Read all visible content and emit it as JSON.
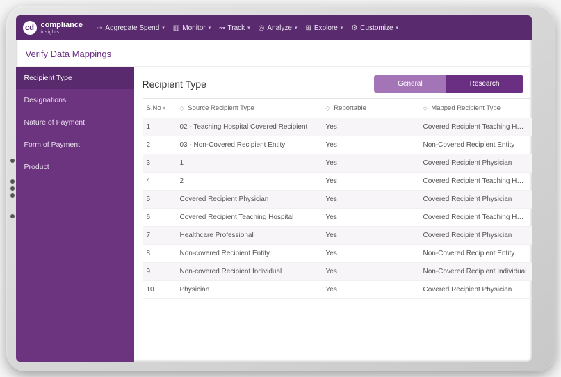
{
  "brand": {
    "name": "compliance",
    "sub": "insights",
    "logo_text": "cd"
  },
  "topnav": [
    {
      "label": "Aggregate Spend"
    },
    {
      "label": "Monitor"
    },
    {
      "label": "Track"
    },
    {
      "label": "Analyze"
    },
    {
      "label": "Explore"
    },
    {
      "label": "Customize"
    }
  ],
  "page_title": "Verify Data Mappings",
  "sidebar": {
    "items": [
      {
        "label": "Recipient Type",
        "active": true
      },
      {
        "label": "Designations"
      },
      {
        "label": "Nature of Payment"
      },
      {
        "label": "Form of Payment"
      },
      {
        "label": "Product"
      }
    ]
  },
  "main": {
    "title": "Recipient Type",
    "tabs": {
      "general": "General",
      "research": "Research"
    },
    "columns": {
      "sno": "S.No",
      "source": "Source Recipient Type",
      "reportable": "Reportable",
      "mapped": "Mapped Recipient Type"
    },
    "rows": [
      {
        "sno": "1",
        "source": "02 - Teaching Hospital Covered Recipient",
        "reportable": "Yes",
        "mapped": "Covered Recipient Teaching Hospital"
      },
      {
        "sno": "2",
        "source": "03 - Non-Covered Recipient Entity",
        "reportable": "Yes",
        "mapped": "Non-Covered Recipient Entity"
      },
      {
        "sno": "3",
        "source": "1",
        "reportable": "Yes",
        "mapped": "Covered Recipient Physician"
      },
      {
        "sno": "4",
        "source": "2",
        "reportable": "Yes",
        "mapped": "Covered Recipient Teaching Hospital"
      },
      {
        "sno": "5",
        "source": "Covered Recipient Physician",
        "reportable": "Yes",
        "mapped": "Covered Recipient Physician"
      },
      {
        "sno": "6",
        "source": "Covered Recipient Teaching Hospital",
        "reportable": "Yes",
        "mapped": "Covered Recipient Teaching Hospital"
      },
      {
        "sno": "7",
        "source": "Healthcare Professional",
        "reportable": "Yes",
        "mapped": "Covered Recipient Physician"
      },
      {
        "sno": "8",
        "source": "Non-covered Recipient Entity",
        "reportable": "Yes",
        "mapped": "Non-Covered Recipient Entity"
      },
      {
        "sno": "9",
        "source": "Non-covered Recipient Individual",
        "reportable": "Yes",
        "mapped": "Non-Covered Recipient Individual"
      },
      {
        "sno": "10",
        "source": "Physician",
        "reportable": "Yes",
        "mapped": "Covered Recipient Physician"
      }
    ]
  }
}
